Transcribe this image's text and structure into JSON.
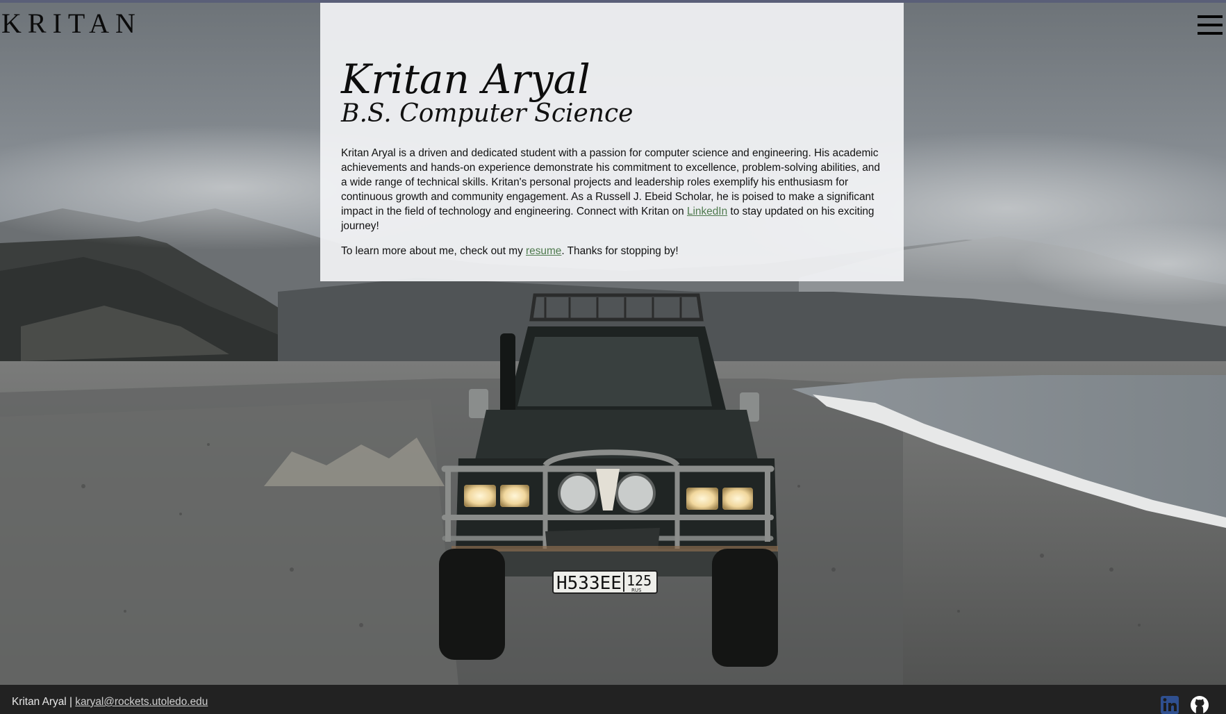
{
  "brand": {
    "logo_text": "KRITAN"
  },
  "nav": {
    "menu_icon": "hamburger-menu-icon"
  },
  "hero": {
    "name": "Kritan Aryal",
    "degree": "B.S. Computer Science",
    "bio_before_link": "Kritan Aryal is a driven and dedicated student with a passion for computer science and engineering. His academic achievements and hands-on experience demonstrate his commitment to excellence, problem-solving abilities, and a wide range of technical skills. Kritan's personal projects and leadership roles exemplify his enthusiasm for continuous growth and community engagement. As a Russell J. Ebeid Scholar, he is poised to make a significant impact in the field of technology and engineering. Connect with Kritan on ",
    "bio_link": "LinkedIn",
    "bio_after_link": " to stay updated on his exciting journey!",
    "more_before_link": "To learn more about me, check out my ",
    "more_link": "resume",
    "more_after_link": ". Thanks for stopping by!"
  },
  "footer": {
    "name": "Kritan Aryal | ",
    "email": "karyal@rockets.utoledo.edu",
    "icons": [
      "linkedin-icon",
      "github-icon"
    ]
  },
  "background": {
    "plate_main": "H533EE",
    "plate_region": "125",
    "plate_country": "RUS"
  },
  "colors": {
    "card_background": "#f2f3f5",
    "link": "#4f7a4e",
    "footer": "#222222",
    "linkedin_blue": "#2f4f8f"
  }
}
